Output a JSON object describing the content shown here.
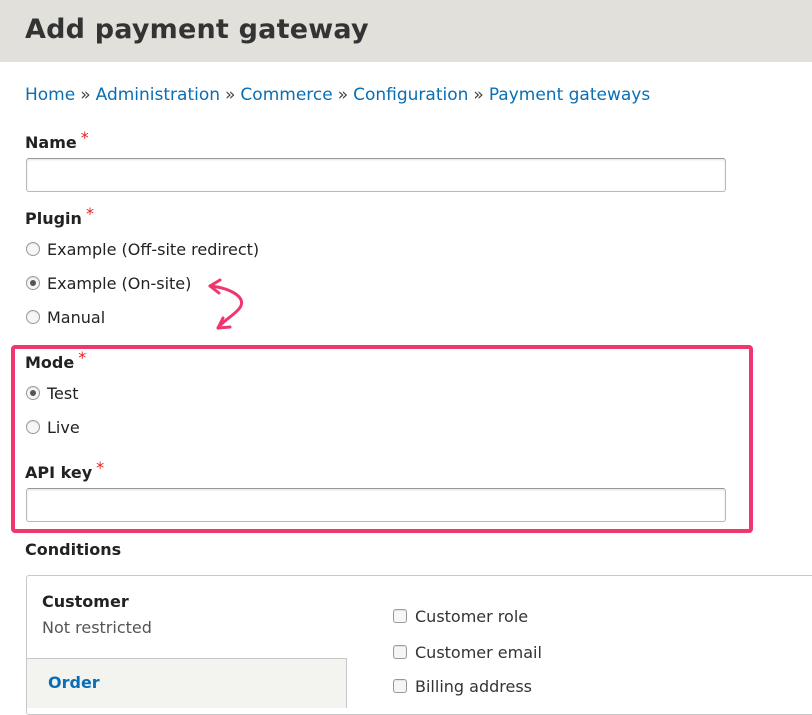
{
  "header": {
    "title": "Add payment gateway"
  },
  "breadcrumb": {
    "items": [
      "Home",
      "Administration",
      "Commerce",
      "Configuration",
      "Payment gateways"
    ],
    "separator": "»"
  },
  "form": {
    "name": {
      "label": "Name",
      "required_mark": "*",
      "value": ""
    },
    "plugin": {
      "label": "Plugin",
      "required_mark": "*",
      "options": [
        "Example (Off-site redirect)",
        "Example (On-site)",
        "Manual"
      ],
      "selected": "Example (On-site)"
    },
    "mode": {
      "label": "Mode",
      "required_mark": "*",
      "options": [
        "Test",
        "Live"
      ],
      "selected": "Test"
    },
    "api_key": {
      "label": "API key",
      "required_mark": "*",
      "value": ""
    },
    "conditions": {
      "label": "Conditions",
      "tabs": [
        {
          "title": "Customer",
          "summary": "Not restricted"
        },
        {
          "title": "Order"
        }
      ],
      "checkboxes": [
        "Customer role",
        "Customer email",
        "Billing address"
      ]
    }
  },
  "colors": {
    "highlight": "#f0366e",
    "link": "#0a6eb4",
    "required": "#e02020",
    "header_bg": "#e1e0db"
  },
  "annotations": {
    "arrow_icon": "curved-double-arrow-icon"
  }
}
